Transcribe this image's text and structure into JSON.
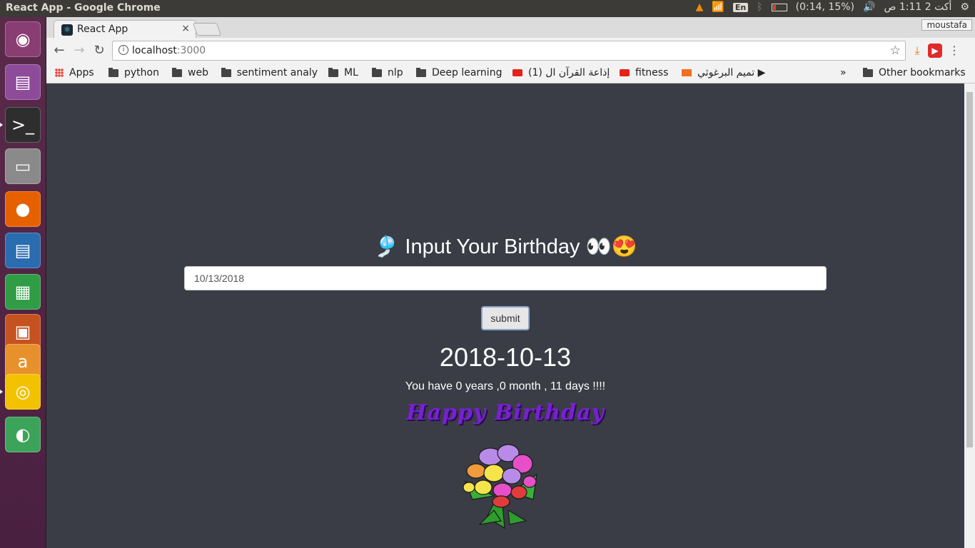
{
  "topbar": {
    "window_title": "React App - Google Chrome",
    "keyboard_lang": "En",
    "battery_text": "(0:14, 15%)",
    "clock": "أكت 2  1:11 ص"
  },
  "launcher": {
    "items": [
      {
        "name": "ubuntu-dash",
        "glyph": "◉",
        "bg": "#8a3d72"
      },
      {
        "name": "workspace-app",
        "glyph": "▤",
        "bg": "#8e4b9a"
      },
      {
        "name": "terminal",
        "glyph": ">_",
        "bg": "#2e2e2e"
      },
      {
        "name": "files",
        "glyph": "▭",
        "bg": "#8a8a8a"
      },
      {
        "name": "firefox",
        "glyph": "●",
        "bg": "#e66000"
      },
      {
        "name": "libreoffice-writer",
        "glyph": "▤",
        "bg": "#2a6cb0"
      },
      {
        "name": "libreoffice-calc",
        "glyph": "▦",
        "bg": "#2f9d45"
      },
      {
        "name": "libreoffice-impress",
        "glyph": "▣",
        "bg": "#c6531f"
      },
      {
        "name": "amazon",
        "glyph": "a",
        "bg": "#e8912c"
      },
      {
        "name": "chrome",
        "glyph": "◎",
        "bg": "#f2c200"
      },
      {
        "name": "android-studio",
        "glyph": "◐",
        "bg": "#3ca45a"
      }
    ]
  },
  "browser": {
    "tab_title": "React App",
    "tab_close": "×",
    "profile_name": "moustafa",
    "url_host": "localhost",
    "url_port": ":3000",
    "bookmarks": {
      "apps": "Apps",
      "python": "python",
      "web": "web",
      "sentiment": "sentiment analy",
      "ml": "ML",
      "nlp": "nlp",
      "deep_learning": "Deep learning",
      "quran": "(1) إذاعة القرآن ال",
      "fitness": "fitness",
      "tamim": "تميم البرغوثي ▶",
      "more": "»",
      "other": "Other bookmarks"
    }
  },
  "page": {
    "heading": "🎐 Input Your Birthday 👀😍",
    "input_value": "10/13/2018",
    "submit_label": "submit",
    "result_date": "2018-10-13",
    "age_text": "You have 0 years ,0 month , 11 days !!!!",
    "greeting": "Happy Birthday"
  },
  "colors": {
    "page_bg": "#3a3d45",
    "greeting": "#7a1fd6"
  }
}
